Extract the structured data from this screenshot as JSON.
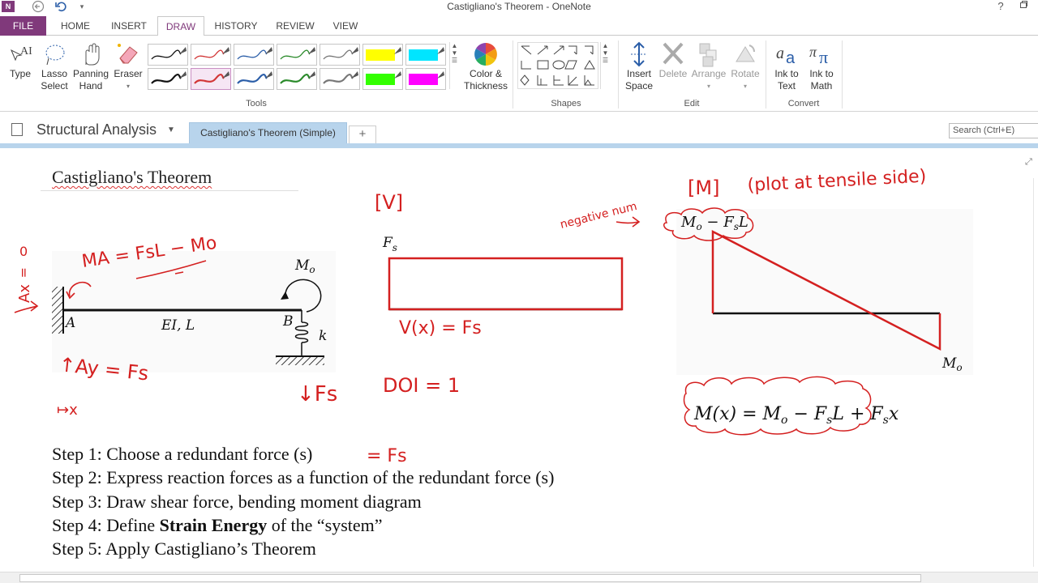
{
  "window": {
    "title": "Castigliano's Theorem - OneNote",
    "help_label": "?",
    "icons": [
      "back-icon",
      "undo-icon",
      "quick-access-icon",
      "restore-icon",
      "close-icon"
    ]
  },
  "ribbon_tabs": [
    "FILE",
    "HOME",
    "INSERT",
    "DRAW",
    "HISTORY",
    "REVIEW",
    "VIEW"
  ],
  "active_tab": "DRAW",
  "accent_color": "#80397b",
  "tools": {
    "type_label": "Type",
    "lasso_label_1": "Lasso",
    "lasso_label_2": "Select",
    "panning_label_1": "Panning",
    "panning_label_2": "Hand",
    "eraser_label": "Eraser",
    "group_label": "Tools",
    "pens_row1": [
      "#111111",
      "#d23636",
      "#2b5ea8",
      "#2a8a2a",
      "#777777",
      "#ffff00",
      "#00e5ff"
    ],
    "pens_row2": [
      "#111111",
      "#d23636",
      "#2b5ea8",
      "#2a8a2a",
      "#777777",
      "#33ff00",
      "#ff00ff"
    ],
    "color_thickness_label_1": "Color &",
    "color_thickness_label_2": "Thickness"
  },
  "shapes": {
    "group_label": "Shapes"
  },
  "edit": {
    "insert_space_1": "Insert",
    "insert_space_2": "Space",
    "delete_label": "Delete",
    "arrange_label": "Arrange",
    "rotate_label": "Rotate",
    "group_label": "Edit"
  },
  "convert": {
    "ink_to_text_1": "Ink to",
    "ink_to_text_2": "Text",
    "ink_to_math_1": "Ink to",
    "ink_to_math_2": "Math",
    "group_label": "Convert"
  },
  "notebook": {
    "name": "Structural Analysis"
  },
  "page_tab": "Castigliano's Theorem (Simple)",
  "add_tab_label": "+",
  "search": {
    "placeholder": "Search (Ctrl+E)"
  },
  "page": {
    "title": "Castigliano's Theorem",
    "steps": [
      {
        "prefix": "Step 1: Choose a redundant force (s)",
        "bold": "",
        "suffix": ""
      },
      {
        "prefix": "Step 2: Express reaction forces as a function of the redundant force (s)",
        "bold": "",
        "suffix": ""
      },
      {
        "prefix": "Step 3: Draw shear force, bending moment diagram",
        "bold": "",
        "suffix": ""
      },
      {
        "prefix": "Step 4: Define ",
        "bold": "Strain Energy",
        "suffix": " of the “system”"
      },
      {
        "prefix": "Step 5: Apply Castigliano’s Theorem",
        "bold": "",
        "suffix": ""
      }
    ],
    "beam": {
      "label_A": "A",
      "label_B": "B",
      "label_EI": "EI, L",
      "label_Mo": "M",
      "label_Mo_sub": "o",
      "label_k": "k"
    },
    "shear": {
      "label": "F",
      "label_sub": "s"
    },
    "moment": {
      "label_top": "M",
      "label_top_rest": " − F",
      "label_end": "M",
      "label_end_sub": "o",
      "equation": "M(x) = M",
      "equation_rest": " − F",
      "equation_L": "L + F",
      "equation_x": "x"
    },
    "ink": {
      "ma_eq": "MA = FsL − Mo",
      "ay_eq": "↑Ay = Fs",
      "zero_stack_top": "0",
      "zero_stack_mid": "=",
      "zero_stack_bottom": "Ax",
      "x_axis": "↦x",
      "down_fs": "↓Fs",
      "v_label": "[V]",
      "v_eq": "V(x) = Fs",
      "doi": "DOI = 1",
      "negative_num": "negative num",
      "m_label": "[M]",
      "plot_note": "(plot at tensile side)",
      "step1_ink": "= Fs"
    }
  },
  "ink_color": "#d42020"
}
